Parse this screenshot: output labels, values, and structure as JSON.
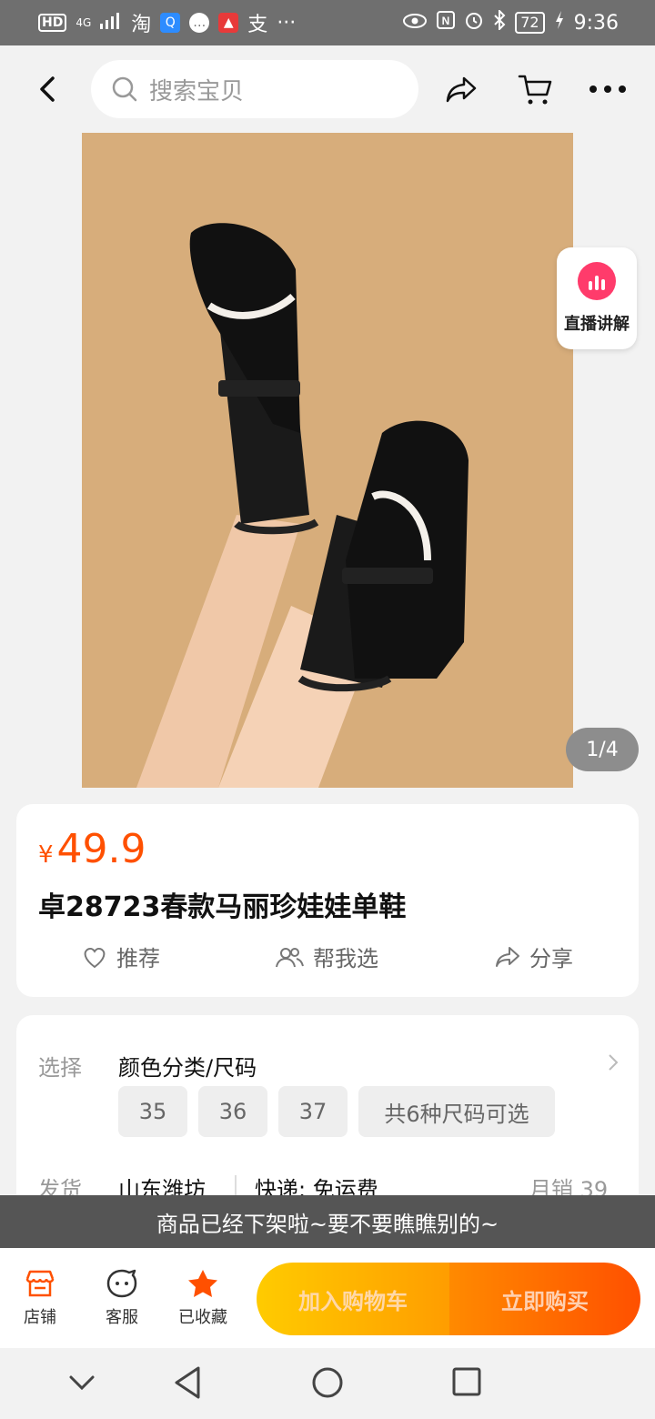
{
  "status_bar": {
    "hd": "HD",
    "network": "4G",
    "battery": "72",
    "time": "9:36",
    "apps": [
      "淘",
      "支",
      "···"
    ]
  },
  "header": {
    "search_placeholder": "搜索宝贝"
  },
  "gallery": {
    "pager": "1/4",
    "live_label": "直播讲解"
  },
  "product": {
    "currency": "¥",
    "price": "49.9",
    "title": "卓28723春款马丽珍娃娃单鞋"
  },
  "actions": {
    "recommend": "推荐",
    "help_choose": "帮我选",
    "share": "分享"
  },
  "options": {
    "select_label": "选择",
    "select_value": "颜色分类/尺码",
    "sizes": [
      "35",
      "36",
      "37"
    ],
    "more_sizes": "共6种尺码可选",
    "ship_label": "发货",
    "ship_from": "山东潍坊",
    "delivery": "快递: 免运费",
    "monthly_sales": "月销 39"
  },
  "toast": "商品已经下架啦~要不要瞧瞧别的~",
  "bottom_bar": {
    "shop": "店铺",
    "service": "客服",
    "favorited": "已收藏",
    "add_to_cart": "加入购物车",
    "buy_now": "立即购买"
  },
  "colors": {
    "accent": "#ff5000",
    "cart_btn": "#ffb300",
    "buy_btn": "#ff6a00"
  }
}
